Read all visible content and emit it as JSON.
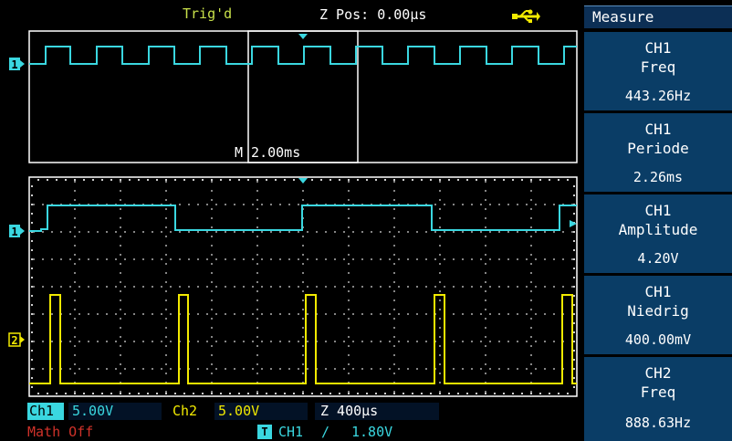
{
  "header": {
    "trigger_status": "Trig'd",
    "z_pos": "Z Pos: 0.00µs",
    "usb_icon": "usb-icon"
  },
  "overview": {
    "window_label": "M 2.00ms",
    "ch1_marker": "1"
  },
  "main": {
    "ch1_marker": "1",
    "ch2_marker": "2"
  },
  "measure": {
    "title": "Measure",
    "items": [
      {
        "channel": "CH1",
        "name": "Freq",
        "value": "443.26Hz"
      },
      {
        "channel": "CH1",
        "name": "Periode",
        "value": "2.26ms"
      },
      {
        "channel": "CH1",
        "name": "Amplitude",
        "value": "4.20V"
      },
      {
        "channel": "CH1",
        "name": "Niedrig",
        "value": "400.00mV"
      },
      {
        "channel": "CH2",
        "name": "Freq",
        "value": "888.63Hz"
      }
    ]
  },
  "status_bar": {
    "ch1_label": "Ch1",
    "ch1_scale": "5.00V",
    "ch2_label": "Ch2",
    "ch2_scale": "5.00V",
    "timebase": "Z 400µs",
    "math": "Math Off",
    "trig_source_icon": "T",
    "trig_source": "CH1",
    "trig_slope": "∕",
    "trig_level": "1.80V"
  },
  "colors": {
    "ch1": "#3ad7e0",
    "ch2": "#f2ea00",
    "panel": "#0a3d66",
    "grid": "#cfcfcf",
    "header_text": "#c8e04a",
    "math": "#d0322a"
  }
}
